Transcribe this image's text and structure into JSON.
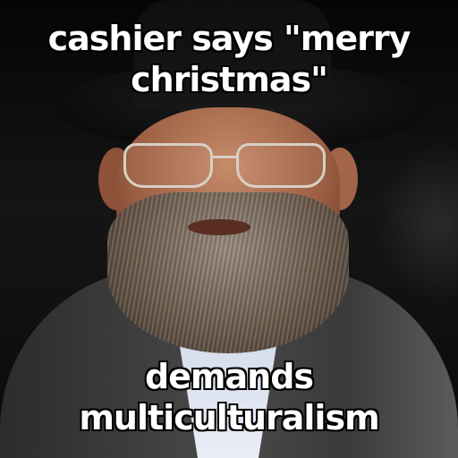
{
  "meme": {
    "top_text": [
      "cashier says \"merry",
      "christmas\""
    ],
    "bottom_text": [
      "demands",
      "multiculturalism"
    ]
  }
}
